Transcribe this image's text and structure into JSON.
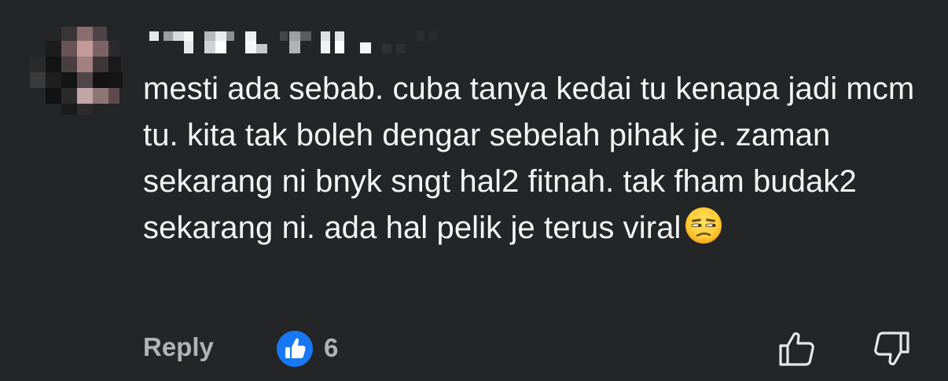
{
  "comment": {
    "author_name": "",
    "text": "mesti ada sebab. cuba tanya kedai tu kenapa jadi mcm tu. kita tak boleh dengar sebelah pihak je. zaman sekarang ni bnyk sngt hal2 fitnah. tak fham budak2 sekarang ni. ada hal pelik je terus viral",
    "emoji": "unamused-face-icon"
  },
  "actions": {
    "reply_label": "Reply",
    "reaction_icon": "like-icon",
    "reaction_count": "6",
    "upvote_icon": "thumbs-up-icon",
    "downvote_icon": "thumbs-down-icon"
  },
  "colors": {
    "background": "#242526",
    "text": "#f5f6f7",
    "secondary_text": "#b0b3b8",
    "like_blue": "#1877f2"
  }
}
